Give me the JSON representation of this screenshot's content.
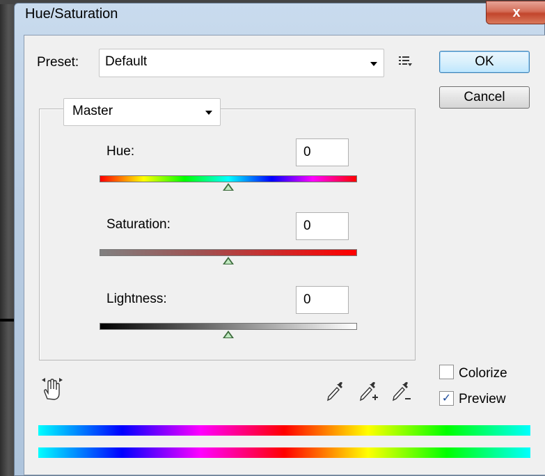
{
  "window": {
    "title": "Hue/Saturation",
    "close_glyph": "x"
  },
  "preset": {
    "label": "Preset:",
    "value": "Default",
    "menu_icon": "list-menu-icon"
  },
  "buttons": {
    "ok": "OK",
    "cancel": "Cancel"
  },
  "channel": {
    "value": "Master"
  },
  "hue": {
    "label": "Hue:",
    "value": "0",
    "level": 0.5
  },
  "saturation": {
    "label": "Saturation:",
    "value": "0",
    "level": 0.5
  },
  "lightness": {
    "label": "Lightness:",
    "value": "0",
    "level": 0.5
  },
  "options": {
    "colorize": {
      "label": "Colorize",
      "checked": false
    },
    "preview": {
      "label": "Preview",
      "checked": true,
      "mark": "✓"
    }
  },
  "tools": [
    "on-image-adjust-hand-icon",
    "eyedropper-icon",
    "eyedropper-plus-icon",
    "eyedropper-minus-icon"
  ],
  "colors": {
    "accent": "#3c7fb1",
    "thumb": "#3b6a3b",
    "window_frame": "#c9dbee"
  }
}
